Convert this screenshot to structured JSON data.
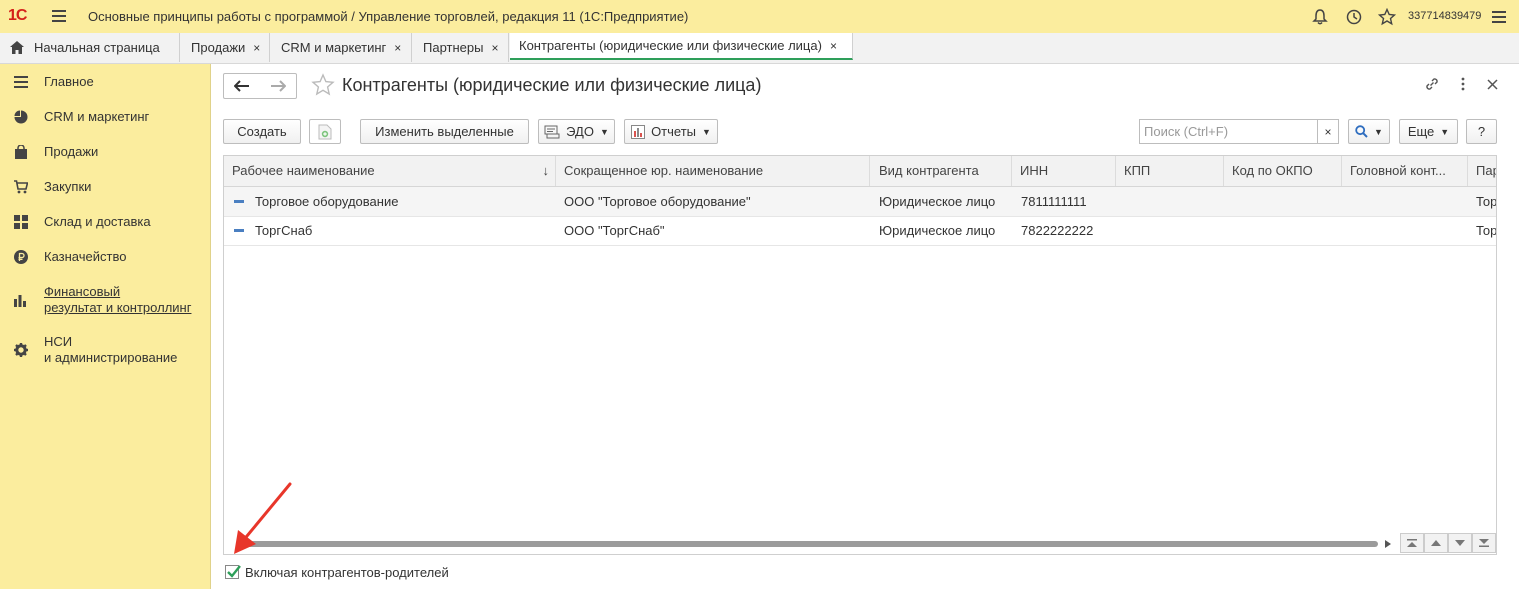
{
  "app": {
    "logo": "1С",
    "title": "Основные принципы работы с программой / Управление торговлей, редакция 11  (1С:Предприятие)",
    "user": "337714839479"
  },
  "tabs": [
    {
      "label": "Начальная страница",
      "closable": false
    },
    {
      "label": "Продажи",
      "closable": true
    },
    {
      "label": "CRM и маркетинг",
      "closable": true
    },
    {
      "label": "Партнеры",
      "closable": true
    },
    {
      "label": "Контрагенты (юридические или физические лица)",
      "closable": true,
      "active": true
    }
  ],
  "tab_close": "×",
  "sidebar": {
    "items": [
      {
        "label": "Главное",
        "icon": "menu-icon"
      },
      {
        "label": "CRM и маркетинг",
        "icon": "pie-chart-icon"
      },
      {
        "label": "Продажи",
        "icon": "bag-icon"
      },
      {
        "label": "Закупки",
        "icon": "cart-icon"
      },
      {
        "label": "Склад и доставка",
        "icon": "grid-icon"
      },
      {
        "label": "Казначейство",
        "icon": "ruble-icon"
      },
      {
        "label": "Финансовый\nрезультат и контроллинг",
        "icon": "bar-chart-icon"
      },
      {
        "label": "НСИ\nи администрирование",
        "icon": "gear-icon"
      }
    ]
  },
  "page": {
    "title": "Контрагенты (юридические или физические лица)"
  },
  "toolbar": {
    "create": "Создать",
    "edit_selected": "Изменить выделенные",
    "edo": "ЭДО",
    "reports": "Отчеты",
    "search_placeholder": "Поиск (Ctrl+F)",
    "clear": "×",
    "more": "Еще",
    "help": "?"
  },
  "table": {
    "columns": [
      "Рабочее наименование",
      "Сокращенное юр. наименование",
      "Вид контрагента",
      "ИНН",
      "КПП",
      "Код по ОКПО",
      "Головной конт...",
      "Пар"
    ],
    "sort_indicator": "↓",
    "rows": [
      [
        "Торговое оборудование",
        "ООО \"Торговое оборудование\"",
        "Юридическое лицо",
        "7811111111",
        "",
        "",
        "",
        "Тор"
      ],
      [
        "ТоргСнаб",
        "ООО \"ТоргСнаб\"",
        "Юридическое лицо",
        "7822222222",
        "",
        "",
        "",
        "Тор"
      ]
    ]
  },
  "footer": {
    "include_parents_label": "Включая контрагентов-родителей",
    "include_parents_checked": true
  },
  "colors": {
    "titlebar": "#fbed9e",
    "accent_green": "#2e9f5a",
    "arrow_red": "#e8362a"
  }
}
